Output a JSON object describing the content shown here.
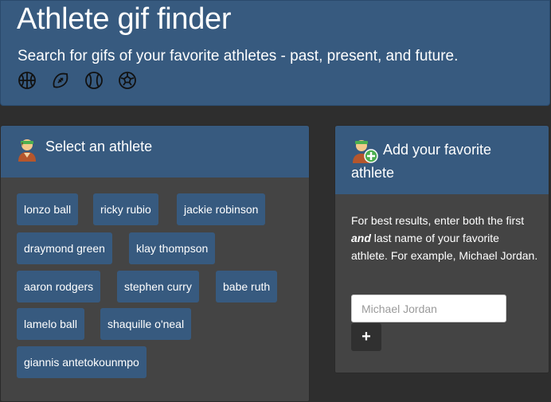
{
  "header": {
    "title": "Athlete gif finder",
    "subtitle": "Search for gifs of your favorite athletes - past, present, and future.",
    "sport_icons": [
      "basketball-icon",
      "football-icon",
      "baseball-icon",
      "soccer-ball-icon"
    ]
  },
  "select_panel": {
    "title": "Select an athlete",
    "icon": "athlete-avatar-icon",
    "athletes": [
      "lonzo ball",
      "ricky rubio",
      "jackie robinson",
      "draymond green",
      "klay thompson",
      "aaron rodgers",
      "stephen curry",
      "babe ruth",
      "lamelo ball",
      "shaquille o'neal",
      "giannis antetokounmpo"
    ]
  },
  "add_panel": {
    "title": "Add your favorite athlete",
    "icon": "add-athlete-icon",
    "help_before": "For best results, enter both the first ",
    "help_emphasis": "and",
    "help_after": " last name of your favorite athlete. For example, Michael Jordan.",
    "input_placeholder": "Michael Jordan",
    "input_value": "",
    "add_button_symbol": "+"
  },
  "colors": {
    "background": "#2e2e2e",
    "primary": "#375a7f",
    "panel_body": "#444444",
    "dark_button": "#303030"
  }
}
